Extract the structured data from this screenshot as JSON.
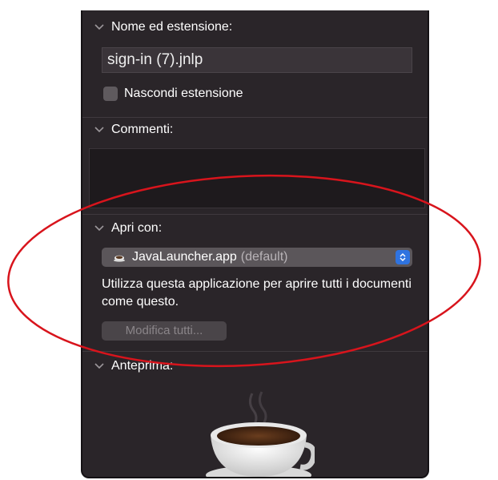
{
  "sections": {
    "name_ext": {
      "title": "Nome ed estensione:",
      "filename": "sign-in (7).jnlp",
      "hide_ext_label": "Nascondi estensione"
    },
    "comments": {
      "title": "Commenti:"
    },
    "open_with": {
      "title": "Apri con:",
      "app_name": "JavaLauncher.app",
      "app_default": "(default)",
      "description": "Utilizza questa applicazione per aprire tutti i documenti come questo.",
      "modify_all_label": "Modifica tutti..."
    },
    "preview": {
      "title": "Anteprima:"
    }
  },
  "icons": {
    "chevron": "chevron-down-icon",
    "app": "coffee-cup-icon",
    "stepper": "up-down-chevron-icon"
  },
  "colors": {
    "panel_bg": "#2a2529",
    "accent": "#2f73e0",
    "annotation": "#d8141c"
  }
}
